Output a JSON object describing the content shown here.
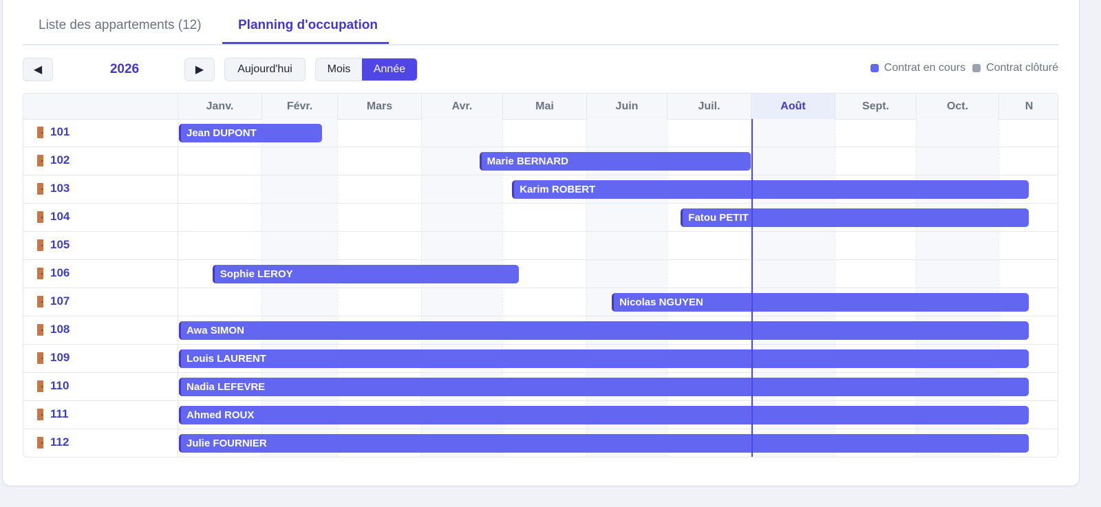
{
  "tabs": [
    {
      "label": "Liste des appartements (12)",
      "active": false
    },
    {
      "label": "Planning d'occupation",
      "active": true
    }
  ],
  "toolbar": {
    "prev_icon": "triangle-left-icon",
    "next_icon": "triangle-right-icon",
    "prev_glyph": "◀",
    "next_glyph": "▶",
    "year": "2026",
    "today_label": "Aujourd'hui",
    "view_month": "Mois",
    "view_year": "Année"
  },
  "legend": {
    "active_label": "Contrat en cours",
    "active_color": "#6366f1",
    "closed_label": "Contrat clôturé",
    "closed_color": "#9ca3af"
  },
  "months": [
    "Janv.",
    "Févr.",
    "Mars",
    "Avr.",
    "Mai",
    "Juin",
    "Juil.",
    "Août",
    "Sept.",
    "Oct.",
    "N"
  ],
  "current_month_index": 7,
  "units": [
    {
      "id": "101",
      "tenant": "Jean DUPONT",
      "start_month": 0,
      "end_month": 1.8
    },
    {
      "id": "102",
      "tenant": "Marie BERNARD",
      "start_month": 3.7,
      "end_month": 7.0
    },
    {
      "id": "103",
      "tenant": "Karim ROBERT",
      "start_month": 4.1,
      "end_month": 10.5
    },
    {
      "id": "104",
      "tenant": "Fatou PETIT",
      "start_month": 6.15,
      "end_month": 10.5
    },
    {
      "id": "105",
      "tenant": "",
      "start_month": null,
      "end_month": null
    },
    {
      "id": "106",
      "tenant": "Sophie LEROY",
      "start_month": 0.4,
      "end_month": 4.2
    },
    {
      "id": "107",
      "tenant": "Nicolas NGUYEN",
      "start_month": 5.3,
      "end_month": 10.5
    },
    {
      "id": "108",
      "tenant": "Awa SIMON",
      "start_month": 0,
      "end_month": 10.5
    },
    {
      "id": "109",
      "tenant": "Louis LAURENT",
      "start_month": 0,
      "end_month": 10.5
    },
    {
      "id": "110",
      "tenant": "Nadia LEFEVRE",
      "start_month": 0,
      "end_month": 10.5
    },
    {
      "id": "111",
      "tenant": "Ahmed ROUX",
      "start_month": 0,
      "end_month": 10.5
    },
    {
      "id": "112",
      "tenant": "Julie FOURNIER",
      "start_month": 0,
      "end_month": 10.5
    }
  ]
}
